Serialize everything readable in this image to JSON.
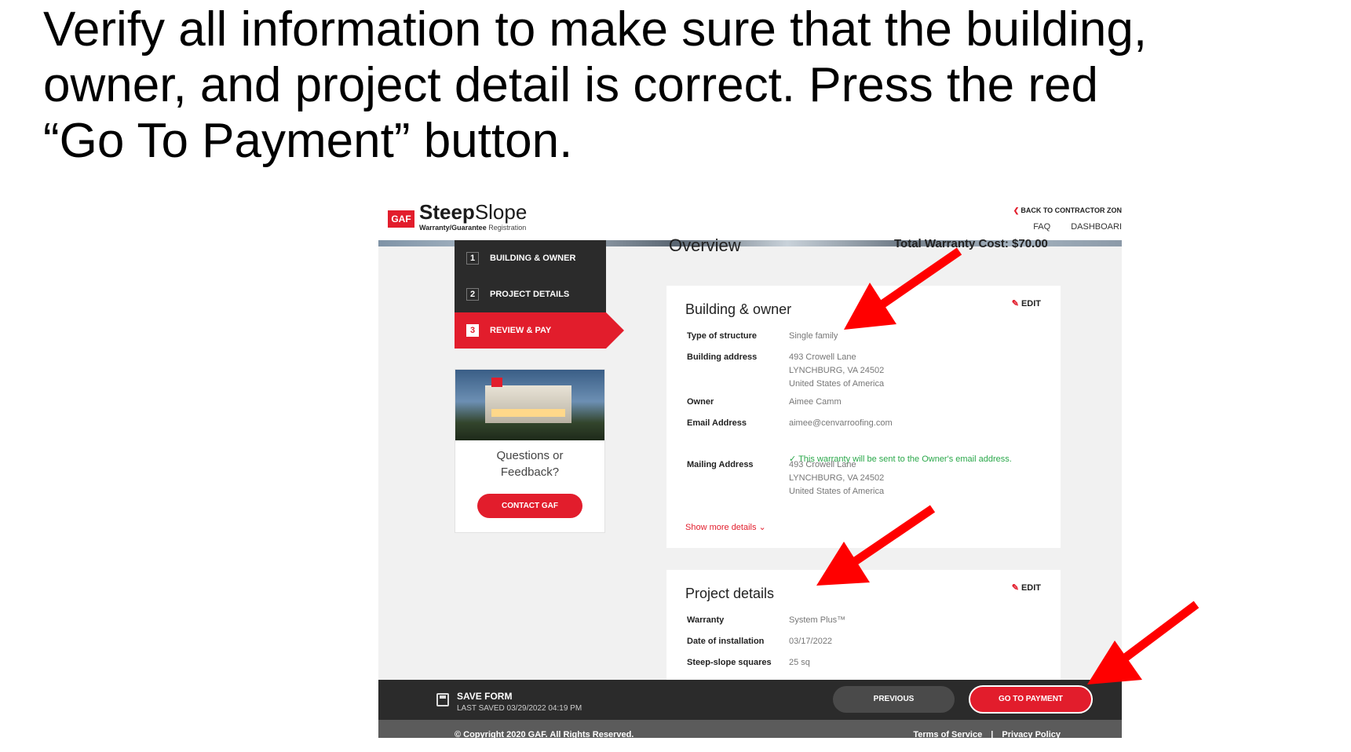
{
  "instruction": {
    "line1": "Verify all information to make sure that the building,",
    "line2": "owner, and project detail is correct.  Press the red",
    "line3": "“Go To Payment” button."
  },
  "header": {
    "logo": "GAF",
    "brand_bold": "Steep",
    "brand_light": "Slope",
    "sub_bold": "Warranty/Guarantee",
    "sub_light": " Registration",
    "back_link": "BACK TO CONTRACTOR ZON",
    "nav": [
      "FAQ",
      "DASHBOARI"
    ]
  },
  "steps": [
    {
      "num": "1",
      "label": "BUILDING & OWNER"
    },
    {
      "num": "2",
      "label": "PROJECT DETAILS"
    },
    {
      "num": "3",
      "label": "REVIEW & PAY"
    }
  ],
  "feedback": {
    "text_line1": "Questions or",
    "text_line2": "Feedback?",
    "button": "CONTACT GAF"
  },
  "overview": {
    "title": "Overview",
    "total_cost": "Total Warranty Cost: $70.00"
  },
  "building_owner": {
    "title": "Building & owner",
    "edit": "EDIT",
    "fields": {
      "structure_label": "Type of structure",
      "structure_value": "Single family",
      "address_label": "Building address",
      "address_line1": "493 Crowell Lane",
      "address_line2": "LYNCHBURG, VA 24502",
      "address_line3": "United States of America",
      "owner_label": "Owner",
      "owner_value": "Aimee Camm",
      "email_label": "Email Address",
      "email_value": "aimee@cenvarroofing.com",
      "mailing_label": "Mailing Address",
      "mailing_line1": "493 Crowell Lane",
      "mailing_line2": "LYNCHBURG, VA 24502",
      "mailing_line3": "United States of America"
    },
    "note": "This warranty will be sent to the Owner's email address.",
    "show_more": "Show more details"
  },
  "project_details": {
    "title": "Project details",
    "edit": "EDIT",
    "warranty_label": "Warranty",
    "warranty_value": "System Plus™",
    "date_label": "Date of installation",
    "date_value": "03/17/2022",
    "squares_label": "Steep-slope squares",
    "squares_value": "25 sq"
  },
  "footer": {
    "save_title": "SAVE FORM",
    "last_saved": "LAST SAVED 03/29/2022 04:19 PM",
    "previous": "PREVIOUS",
    "go_to_payment": "GO TO PAYMENT",
    "copyright": "© Copyright 2020 GAF. All Rights Reserved.",
    "terms": "Terms of Service",
    "separator": "|",
    "privacy": "Privacy Policy"
  },
  "colors": {
    "brand_red": "#e21d2c",
    "annotation_red": "#ff0000",
    "dark_bar": "#2b2b2b",
    "success_green": "#2aa84a"
  }
}
